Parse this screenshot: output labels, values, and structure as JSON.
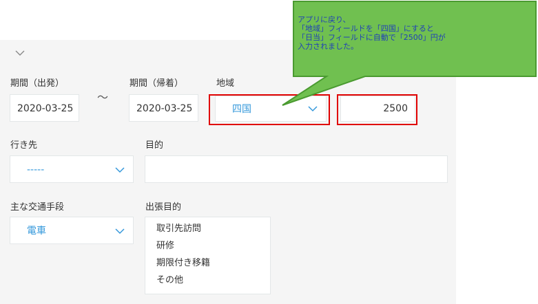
{
  "fields": {
    "period_start": {
      "label": "期間（出発）",
      "value": "2020-03-25"
    },
    "range_sep": "～",
    "period_end": {
      "label": "期間（帰着）",
      "value": "2020-03-25"
    },
    "region": {
      "label": "地域",
      "value": "四国"
    },
    "daily_allowance": {
      "value": "2500"
    },
    "destination": {
      "label": "行き先",
      "value": "-----"
    },
    "purpose": {
      "label": "目的",
      "value": ""
    },
    "transport": {
      "label": "主な交通手段",
      "value": "電車"
    },
    "trip_purpose": {
      "label": "出張目的",
      "options": [
        "取引先訪問",
        "研修",
        "期限付き移籍",
        "その他"
      ]
    }
  },
  "callout": {
    "lines": [
      "アプリに戻り、",
      "「地域」フィールドを「四国」にすると",
      "「日当」フィールドに自動で「2500」円が",
      "入力されました。"
    ]
  },
  "colors": {
    "accent": "#3498db",
    "highlight": "#e00000",
    "callout_fill": "#70c050",
    "callout_border": "#4a9a30",
    "callout_text": "#1f3fb8"
  },
  "icons": {
    "collapse": "chevron-down-icon",
    "dropdown": "chevron-down-icon"
  }
}
